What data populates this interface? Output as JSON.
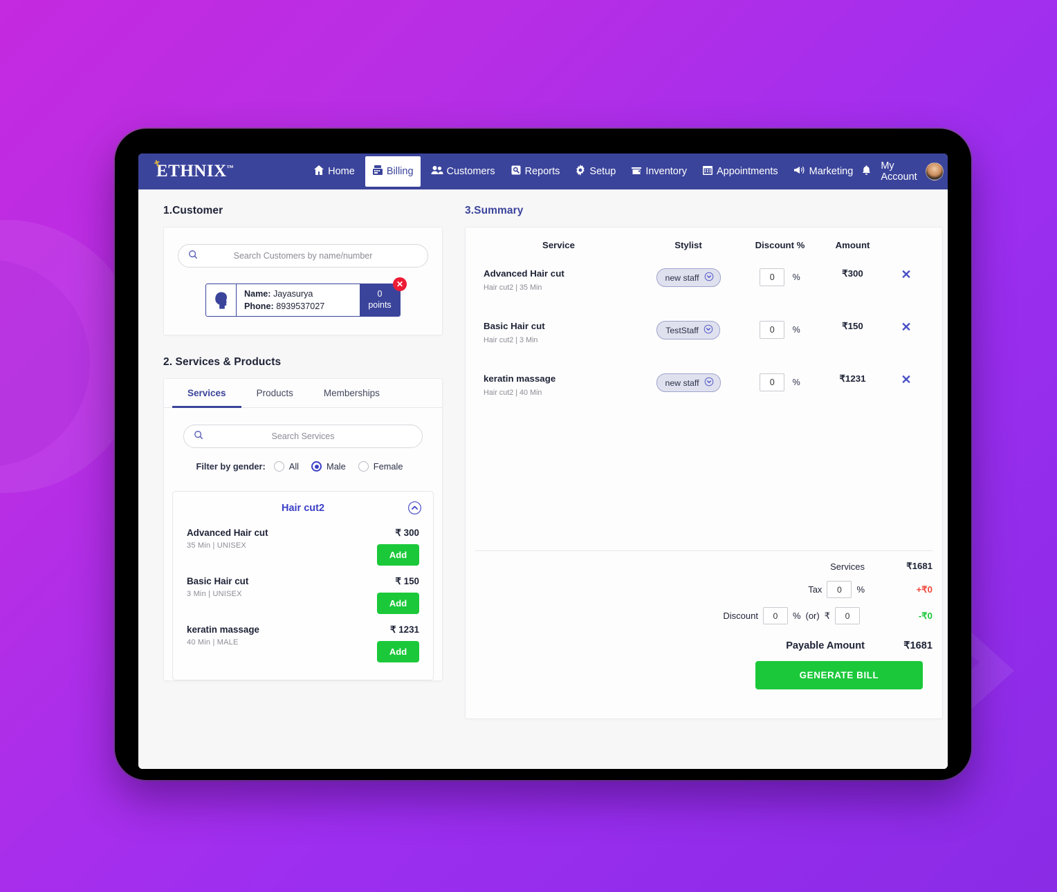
{
  "brand": {
    "name": "ETHNIX",
    "tm": "™"
  },
  "nav": {
    "items": [
      {
        "label": "Home",
        "icon": "home-icon",
        "active": false
      },
      {
        "label": "Billing",
        "icon": "billing-register-icon",
        "active": true
      },
      {
        "label": "Customers",
        "icon": "customers-icon",
        "active": false
      },
      {
        "label": "Reports",
        "icon": "reports-icon",
        "active": false
      },
      {
        "label": "Setup",
        "icon": "gear-icon",
        "active": false
      },
      {
        "label": "Inventory",
        "icon": "inventory-icon",
        "active": false
      },
      {
        "label": "Appointments",
        "icon": "calendar-icon",
        "active": false
      },
      {
        "label": "Marketing",
        "icon": "megaphone-icon",
        "active": false
      }
    ],
    "account_label": "My Account",
    "bell_icon": "notification-bell-icon",
    "avatar_icon": "user-avatar"
  },
  "customer": {
    "title": "1.Customer",
    "search_placeholder": "Search Customers by name/number",
    "search_value": "",
    "chip": {
      "name_label": "Name:",
      "name_value": "Jayasurya",
      "phone_label": "Phone:",
      "phone_value": "8939537027",
      "points_value": "0",
      "points_label": "points",
      "close_glyph": "✕"
    }
  },
  "services_products": {
    "title": "2. Services & Products",
    "tabs": [
      {
        "label": "Services",
        "active": true
      },
      {
        "label": "Products",
        "active": false
      },
      {
        "label": "Memberships",
        "active": false
      }
    ],
    "search_placeholder": "Search Services",
    "search_value": "",
    "gender_filter": {
      "label": "Filter by gender:",
      "options": [
        {
          "label": "All",
          "selected": false
        },
        {
          "label": "Male",
          "selected": true
        },
        {
          "label": "Female",
          "selected": false
        }
      ]
    },
    "group": {
      "name": "Hair cut2",
      "collapse_icon": "chevron-up-circle-icon",
      "items": [
        {
          "name": "Advanced Hair cut",
          "meta": "35 Min | UNISEX",
          "price": "₹ 300",
          "add_label": "Add"
        },
        {
          "name": "Basic Hair cut",
          "meta": "3 Min | UNISEX",
          "price": "₹ 150",
          "add_label": "Add"
        },
        {
          "name": "keratin massage",
          "meta": "40 Min | MALE",
          "price": "₹ 1231",
          "add_label": "Add"
        }
      ]
    }
  },
  "summary": {
    "title": "3.Summary",
    "columns": [
      "Service",
      "Stylist",
      "Discount %",
      "Amount"
    ],
    "rows": [
      {
        "service": "Advanced Hair cut",
        "meta": "Hair cut2 | 35 Min",
        "stylist": "new staff",
        "discount": "0",
        "pct": "%",
        "amount": "₹300",
        "delete_glyph": "✕"
      },
      {
        "service": "Basic Hair cut",
        "meta": "Hair cut2 | 3 Min",
        "stylist": "TestStaff",
        "discount": "0",
        "pct": "%",
        "amount": "₹150",
        "delete_glyph": "✕"
      },
      {
        "service": "keratin massage",
        "meta": "Hair cut2 | 40 Min",
        "stylist": "new staff",
        "discount": "0",
        "pct": "%",
        "amount": "₹1231",
        "delete_glyph": "✕"
      }
    ],
    "totals": {
      "services_label": "Services",
      "services_value": "₹1681",
      "tax_label": "Tax",
      "tax_value": "0",
      "tax_pct": "%",
      "tax_amount": "+₹0",
      "discount_label": "Discount",
      "discount_pct_value": "0",
      "discount_pct_sign": "%",
      "discount_or": "(or)",
      "discount_currency": "₹",
      "discount_amt_value": "0",
      "discount_amount": "-₹0",
      "payable_label": "Payable Amount",
      "payable_value": "₹1681"
    },
    "generate_label": "GENERATE BILL"
  },
  "colors": {
    "nav_blue": "#3b449b",
    "accent_blue": "#3b3fc6",
    "green": "#1bc83a",
    "red": "#ec1c34",
    "tax_red": "#f0473b",
    "background_purple": "#9d2ef0"
  }
}
